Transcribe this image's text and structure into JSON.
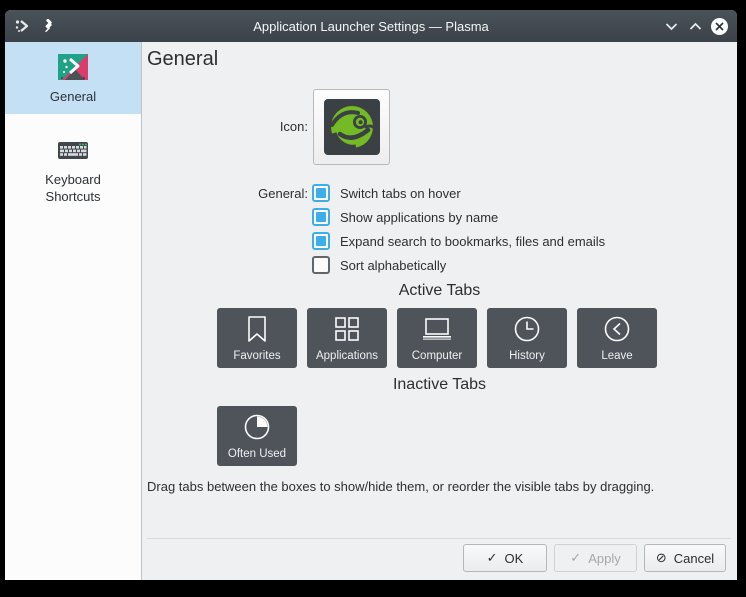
{
  "window": {
    "title": "Application Launcher Settings — Plasma"
  },
  "titlebar": {
    "app_icon": "kickoff-icon",
    "pin_icon": "pin-icon",
    "minimize_icon": "chevron-down-icon",
    "maximize_icon": "chevron-up-icon",
    "close_icon": "close-icon"
  },
  "sidebar": {
    "items": [
      {
        "label": "General",
        "icon": "kickoff-icon",
        "selected": true
      },
      {
        "label": "Keyboard Shortcuts",
        "icon": "keyboard-icon",
        "selected": false
      }
    ]
  },
  "main": {
    "heading": "General",
    "icon_row": {
      "label": "Icon:",
      "icon": "opensuse-geeko-icon"
    },
    "general_options": {
      "label": "General:",
      "items": [
        {
          "label": "Switch tabs on hover",
          "checked": true
        },
        {
          "label": "Show applications by name",
          "checked": true
        },
        {
          "label": "Expand search to bookmarks, files and emails",
          "checked": true
        },
        {
          "label": "Sort alphabetically",
          "checked": false
        }
      ]
    },
    "active_tabs": {
      "heading": "Active Tabs",
      "items": [
        {
          "label": "Favorites",
          "icon": "bookmark-icon"
        },
        {
          "label": "Applications",
          "icon": "app-grid-icon"
        },
        {
          "label": "Computer",
          "icon": "laptop-icon"
        },
        {
          "label": "History",
          "icon": "clock-icon"
        },
        {
          "label": "Leave",
          "icon": "leave-icon"
        }
      ]
    },
    "inactive_tabs": {
      "heading": "Inactive Tabs",
      "items": [
        {
          "label": "Often Used",
          "icon": "pie-chart-icon"
        }
      ]
    },
    "hint": "Drag tabs between the boxes to show/hide them, or reorder the visible tabs by dragging."
  },
  "footer": {
    "buttons": [
      {
        "label": "OK",
        "glyph": "✓",
        "icon": "check-icon",
        "enabled": true
      },
      {
        "label": "Apply",
        "glyph": "✓",
        "icon": "check-icon",
        "enabled": false
      },
      {
        "label": "Cancel",
        "glyph": "⊘",
        "icon": "cancel-icon",
        "enabled": true
      }
    ]
  },
  "colors": {
    "accent": "#3daee9",
    "titlebar": "#414950",
    "sidebar_selection": "#c3e0f5",
    "window_background": "#eff0f1",
    "view_background": "#fcfcfc",
    "dark_tab_button": "#4e545a",
    "geeko_green": "#73ba25"
  }
}
